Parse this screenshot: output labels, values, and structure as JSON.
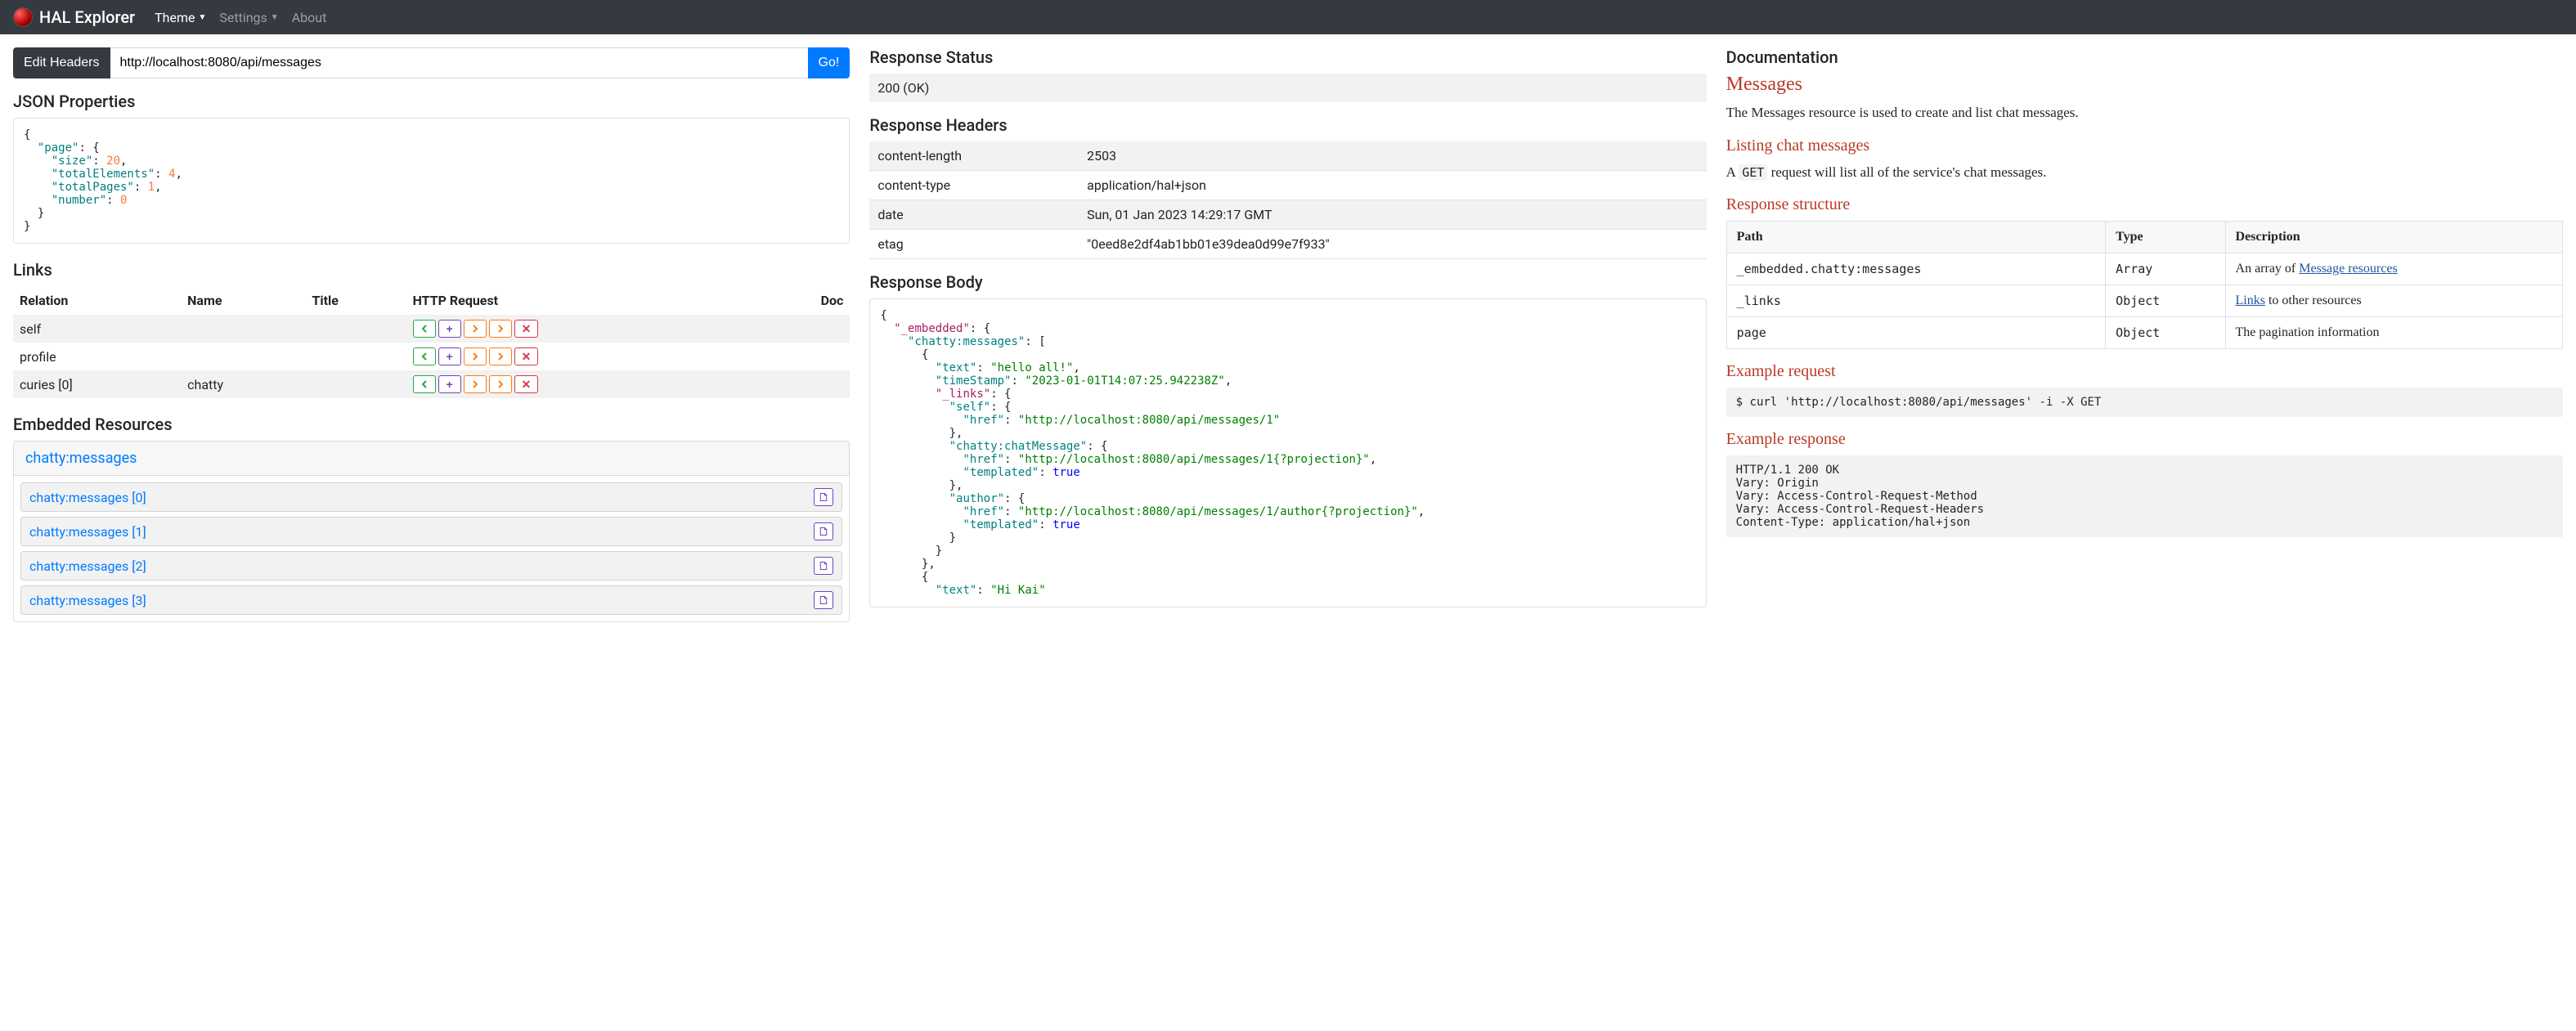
{
  "navbar": {
    "brand": "HAL Explorer",
    "theme": "Theme",
    "settings": "Settings",
    "about": "About"
  },
  "urlbar": {
    "edit_headers": "Edit Headers",
    "url": "http://localhost:8080/api/messages",
    "go": "Go!"
  },
  "left": {
    "json_title": "JSON Properties",
    "json": {
      "page": {
        "size": 20,
        "totalElements": 4,
        "totalPages": 1,
        "number": 0
      }
    },
    "links_title": "Links",
    "links_headers": {
      "relation": "Relation",
      "name": "Name",
      "title": "Title",
      "http": "HTTP Request",
      "doc": "Doc"
    },
    "links_rows": [
      {
        "relation": "self",
        "name": ""
      },
      {
        "relation": "profile",
        "name": ""
      },
      {
        "relation": "curies [0]",
        "name": "chatty"
      }
    ],
    "embedded_title": "Embedded Resources",
    "embedded_group": "chatty:messages",
    "embedded_items": [
      "chatty:messages [0]",
      "chatty:messages [1]",
      "chatty:messages [2]",
      "chatty:messages [3]"
    ]
  },
  "mid": {
    "status_title": "Response Status",
    "status_value": "200 (OK)",
    "headers_title": "Response Headers",
    "headers": [
      {
        "k": "content-length",
        "v": "2503"
      },
      {
        "k": "content-type",
        "v": "application/hal+json"
      },
      {
        "k": "date",
        "v": "Sun, 01 Jan 2023 14:29:17 GMT"
      },
      {
        "k": "etag",
        "v": "\"0eed8e2df4ab1bb01e39dea0d99e7f933\""
      }
    ],
    "body_title": "Response Body",
    "body": {
      "text1": "hello all!",
      "ts1": "2023-01-01T14:07:25.942238Z",
      "href_self": "http://localhost:8080/api/messages/1",
      "href_chat": "http://localhost:8080/api/messages/1{?projection}",
      "href_author": "http://localhost:8080/api/messages/1/author{?projection}",
      "text2": "Hi Kai"
    }
  },
  "doc": {
    "title": "Documentation",
    "h_messages": "Messages",
    "messages_desc": "The Messages resource is used to create and list chat messages.",
    "h_listing": "Listing chat messages",
    "listing_desc_pre": "A ",
    "listing_code": "GET",
    "listing_desc_post": " request will list all of the service's chat messages.",
    "h_response_structure": "Response structure",
    "table_headers": {
      "path": "Path",
      "type": "Type",
      "desc": "Description"
    },
    "rows": [
      {
        "path": "_embedded.chatty:messages",
        "type": "Array",
        "desc_pre": "An array of ",
        "link": "Message resources",
        "desc_post": ""
      },
      {
        "path": "_links",
        "type": "Object",
        "desc_pre": "",
        "link": "Links",
        "desc_post": " to other resources"
      },
      {
        "path": "page",
        "type": "Object",
        "desc_pre": "The pagination information",
        "link": "",
        "desc_post": ""
      }
    ],
    "h_example_request": "Example request",
    "example_request": "$ curl 'http://localhost:8080/api/messages' -i -X GET",
    "h_example_response": "Example response",
    "example_response": "HTTP/1.1 200 OK\nVary: Origin\nVary: Access-Control-Request-Method\nVary: Access-Control-Request-Headers\nContent-Type: application/hal+json"
  }
}
